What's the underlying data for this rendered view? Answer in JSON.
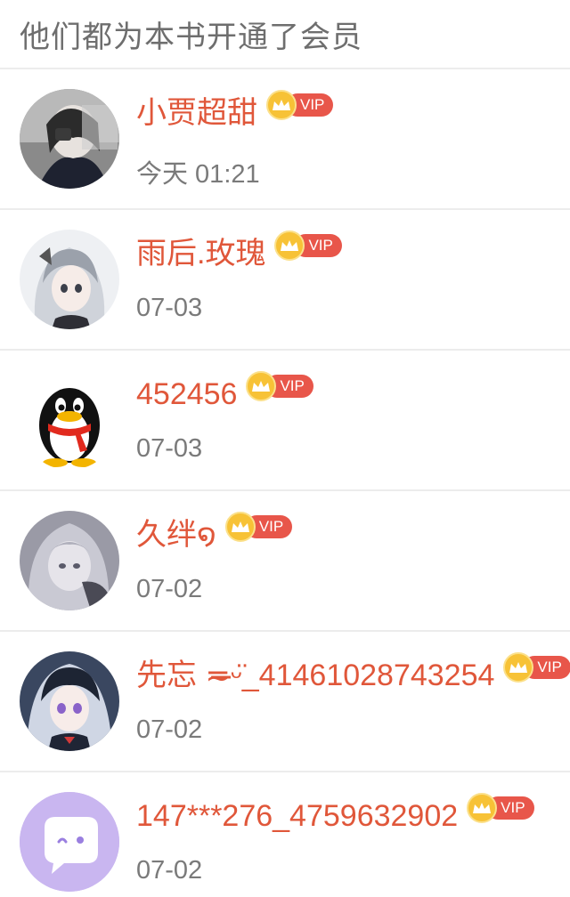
{
  "header": {
    "title": "他们都为本书开通了会员"
  },
  "vip_label": "VIP",
  "colors": {
    "name": "#e0573a",
    "vip_pill": "#e8564a",
    "crown": "#f7c236",
    "divider": "#ececec"
  },
  "members": [
    {
      "name": "小贾超甜",
      "time": "今天 01:21",
      "avatar_icon": "user-photo-avatar"
    },
    {
      "name": "雨后.玫瑰",
      "time": "07-03",
      "avatar_icon": "anime-girl-avatar"
    },
    {
      "name": "452456",
      "time": "07-03",
      "avatar_icon": "qq-penguin-icon"
    },
    {
      "name": "久绊໑",
      "time": "07-02",
      "avatar_icon": "anime-girl-avatar"
    },
    {
      "name": "先忘 ≂̶̶̶ᵕ̈_41461028743254",
      "time": "07-02",
      "avatar_icon": "anime-girl-avatar"
    },
    {
      "name": "147***276_4759632902",
      "time": "07-02",
      "avatar_icon": "default-chat-avatar"
    }
  ]
}
